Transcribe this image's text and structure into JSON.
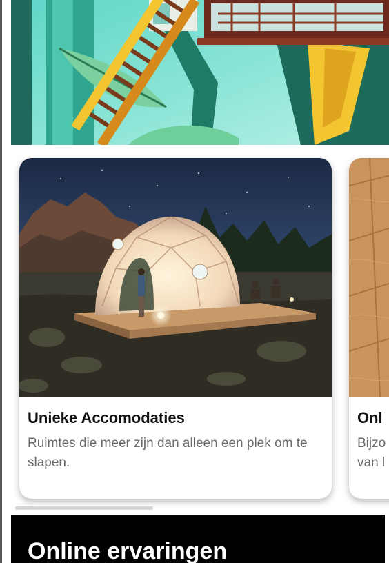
{
  "colors": {
    "page_background": "#ffffff",
    "card_background": "#ffffff",
    "title_text": "#111111",
    "description_text": "#6a6a6a",
    "dark_section": "#000000"
  },
  "hero": {
    "image": "treehouse-illustration"
  },
  "carousel": {
    "cards": [
      {
        "title": "Unieke Accomodaties",
        "description": "Ruimtes die meer zijn dan alleen een plek om te slapen.",
        "image": "geodesic-dome-tent-at-night"
      },
      {
        "title": "Onl",
        "description_line1": "Bijzo",
        "description_line2": "van l",
        "image": "wooden-floor"
      }
    ],
    "scroll_progress": 0.37
  },
  "online_section": {
    "title": "Online ervaringen"
  }
}
